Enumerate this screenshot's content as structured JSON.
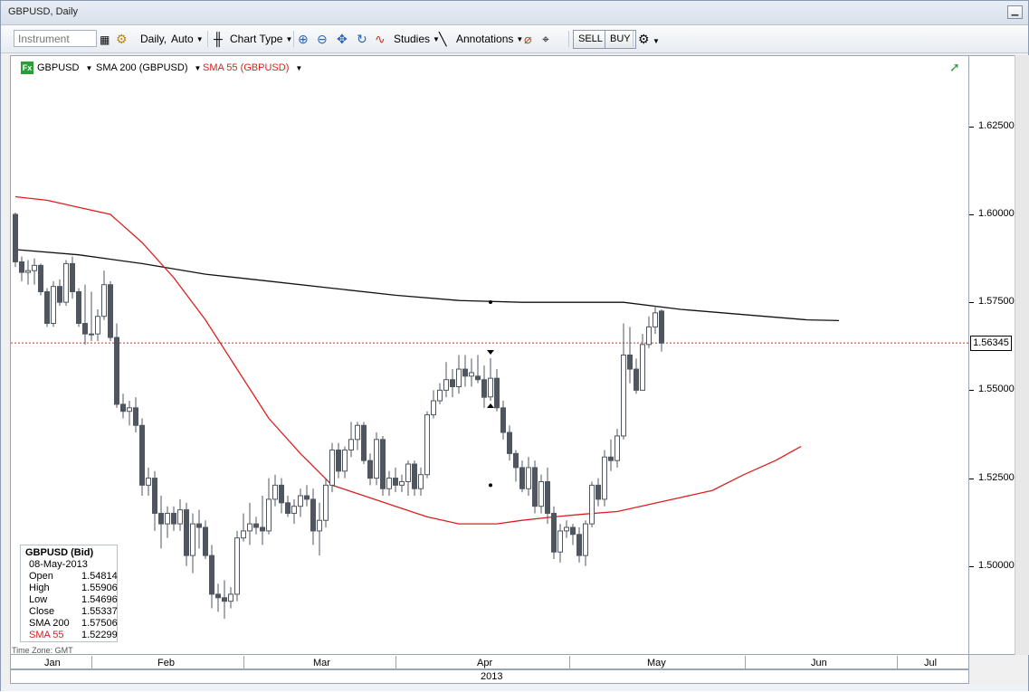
{
  "window": {
    "title": "GBPUSD, Daily"
  },
  "toolbar": {
    "instrument_placeholder": "Instrument",
    "period": "Daily,",
    "scale": "Auto",
    "chart_type": "Chart Type",
    "studies": "Studies",
    "annotations": "Annotations",
    "sell": "SELL",
    "buy": "BUY"
  },
  "legend": {
    "fx": "Fx",
    "instrument": "GBPUSD",
    "sma200": "SMA 200 (GBPUSD)",
    "sma55": "SMA 55 (GBPUSD)"
  },
  "current_price": "1.56345",
  "timezone": "Time Zone: GMT",
  "infobox": {
    "title": "GBPUSD (Bid)",
    "date": "08-May-2013",
    "rows": [
      {
        "label": "Open",
        "value": "1.54814"
      },
      {
        "label": "High",
        "value": "1.55906"
      },
      {
        "label": "Low",
        "value": "1.54696"
      },
      {
        "label": "Close",
        "value": "1.55337"
      },
      {
        "label": "SMA 200",
        "value": "1.57506"
      },
      {
        "label": "SMA 55",
        "value": "1.52299"
      }
    ]
  },
  "colors": {
    "sma200": "#111111",
    "sma55": "#d92020",
    "candle_down": "#4f5660",
    "candle_up": "#ffffff",
    "price_line": "#c0392b"
  },
  "chart_data": {
    "type": "candlestick",
    "y_ticks": [
      "1.62500",
      "1.60000",
      "1.57500",
      "1.55000",
      "1.52500",
      "1.50000"
    ],
    "y_tick_values": [
      1.625,
      1.6,
      1.575,
      1.55,
      1.525,
      1.5
    ],
    "ylim": [
      1.475,
      1.645
    ],
    "x_months": [
      "Jan",
      "Feb",
      "Mar",
      "Apr",
      "May",
      "Jun",
      "Jul"
    ],
    "year": "2013",
    "current_price": 1.56345,
    "candles": [
      [
        1.6,
        1.6005,
        1.585,
        1.5865
      ],
      [
        1.5865,
        1.588,
        1.581,
        1.5835
      ],
      [
        1.5835,
        1.587,
        1.58,
        1.584
      ],
      [
        1.584,
        1.5875,
        1.58,
        1.5855
      ],
      [
        1.5855,
        1.586,
        1.577,
        1.578
      ],
      [
        1.578,
        1.579,
        1.568,
        1.569
      ],
      [
        1.569,
        1.581,
        1.568,
        1.5795
      ],
      [
        1.5795,
        1.5815,
        1.574,
        1.575
      ],
      [
        1.575,
        1.587,
        1.574,
        1.586
      ],
      [
        1.586,
        1.588,
        1.576,
        1.578
      ],
      [
        1.578,
        1.579,
        1.568,
        1.569
      ],
      [
        1.569,
        1.58,
        1.563,
        1.566
      ],
      [
        1.566,
        1.578,
        1.564,
        1.566
      ],
      [
        1.566,
        1.573,
        1.564,
        1.571
      ],
      [
        1.571,
        1.584,
        1.57,
        1.58
      ],
      [
        1.58,
        1.581,
        1.564,
        1.565
      ],
      [
        1.565,
        1.569,
        1.545,
        1.546
      ],
      [
        1.546,
        1.549,
        1.542,
        1.544
      ],
      [
        1.544,
        1.547,
        1.54,
        1.545
      ],
      [
        1.545,
        1.548,
        1.538,
        1.54
      ],
      [
        1.54,
        1.542,
        1.52,
        1.523
      ],
      [
        1.523,
        1.528,
        1.52,
        1.525
      ],
      [
        1.525,
        1.527,
        1.51,
        1.515
      ],
      [
        1.515,
        1.52,
        1.505,
        1.512
      ],
      [
        1.512,
        1.517,
        1.508,
        1.515
      ],
      [
        1.515,
        1.517,
        1.51,
        1.512
      ],
      [
        1.512,
        1.519,
        1.51,
        1.516
      ],
      [
        1.516,
        1.518,
        1.5,
        1.503
      ],
      [
        1.503,
        1.515,
        1.498,
        1.512
      ],
      [
        1.512,
        1.516,
        1.505,
        1.511
      ],
      [
        1.511,
        1.513,
        1.502,
        1.503
      ],
      [
        1.503,
        1.506,
        1.488,
        1.492
      ],
      [
        1.492,
        1.495,
        1.487,
        1.491
      ],
      [
        1.491,
        1.496,
        1.485,
        1.49
      ],
      [
        1.49,
        1.494,
        1.488,
        1.492
      ],
      [
        1.492,
        1.51,
        1.49,
        1.508
      ],
      [
        1.508,
        1.515,
        1.507,
        1.51
      ],
      [
        1.51,
        1.518,
        1.506,
        1.512
      ],
      [
        1.512,
        1.514,
        1.509,
        1.511
      ],
      [
        1.511,
        1.52,
        1.506,
        1.51
      ],
      [
        1.51,
        1.525,
        1.509,
        1.519
      ],
      [
        1.519,
        1.526,
        1.517,
        1.523
      ],
      [
        1.523,
        1.525,
        1.515,
        1.518
      ],
      [
        1.518,
        1.52,
        1.514,
        1.515
      ],
      [
        1.515,
        1.519,
        1.512,
        1.517
      ],
      [
        1.517,
        1.522,
        1.514,
        1.52
      ],
      [
        1.52,
        1.523,
        1.517,
        1.519
      ],
      [
        1.519,
        1.522,
        1.506,
        1.51
      ],
      [
        1.51,
        1.518,
        1.503,
        1.513
      ],
      [
        1.513,
        1.525,
        1.511,
        1.523
      ],
      [
        1.523,
        1.535,
        1.521,
        1.533
      ],
      [
        1.533,
        1.535,
        1.525,
        1.527
      ],
      [
        1.527,
        1.534,
        1.525,
        1.533
      ],
      [
        1.533,
        1.541,
        1.531,
        1.536
      ],
      [
        1.536,
        1.541,
        1.533,
        1.54
      ],
      [
        1.54,
        1.541,
        1.529,
        1.53
      ],
      [
        1.53,
        1.532,
        1.523,
        1.525
      ],
      [
        1.525,
        1.538,
        1.523,
        1.536
      ],
      [
        1.536,
        1.537,
        1.52,
        1.522
      ],
      [
        1.522,
        1.527,
        1.52,
        1.525
      ],
      [
        1.525,
        1.528,
        1.521,
        1.523
      ],
      [
        1.523,
        1.526,
        1.521,
        1.524
      ],
      [
        1.524,
        1.53,
        1.52,
        1.529
      ],
      [
        1.529,
        1.53,
        1.52,
        1.522
      ],
      [
        1.522,
        1.528,
        1.52,
        1.526
      ],
      [
        1.526,
        1.544,
        1.525,
        1.543
      ],
      [
        1.543,
        1.55,
        1.542,
        1.547
      ],
      [
        1.547,
        1.552,
        1.546,
        1.55
      ],
      [
        1.55,
        1.558,
        1.548,
        1.553
      ],
      [
        1.553,
        1.556,
        1.548,
        1.551
      ],
      [
        1.551,
        1.56,
        1.549,
        1.556
      ],
      [
        1.556,
        1.56,
        1.551,
        1.554
      ],
      [
        1.554,
        1.559,
        1.551,
        1.555
      ],
      [
        1.554,
        1.56,
        1.552,
        1.553
      ],
      [
        1.553,
        1.557,
        1.545,
        1.548
      ],
      [
        1.5481,
        1.5591,
        1.547,
        1.5534
      ],
      [
        1.5534,
        1.556,
        1.544,
        1.545
      ],
      [
        1.545,
        1.547,
        1.536,
        1.538
      ],
      [
        1.538,
        1.54,
        1.53,
        1.532
      ],
      [
        1.532,
        1.533,
        1.524,
        1.528
      ],
      [
        1.528,
        1.53,
        1.521,
        1.522
      ],
      [
        1.522,
        1.531,
        1.52,
        1.528
      ],
      [
        1.528,
        1.53,
        1.515,
        1.517
      ],
      [
        1.517,
        1.526,
        1.515,
        1.524
      ],
      [
        1.524,
        1.528,
        1.512,
        1.515
      ],
      [
        1.515,
        1.517,
        1.502,
        1.504
      ],
      [
        1.504,
        1.512,
        1.501,
        1.51
      ],
      [
        1.51,
        1.513,
        1.508,
        1.511
      ],
      [
        1.511,
        1.512,
        1.506,
        1.509
      ],
      [
        1.509,
        1.511,
        1.501,
        1.503
      ],
      [
        1.503,
        1.513,
        1.5,
        1.512
      ],
      [
        1.512,
        1.524,
        1.511,
        1.523
      ],
      [
        1.523,
        1.525,
        1.517,
        1.519
      ],
      [
        1.519,
        1.533,
        1.517,
        1.531
      ],
      [
        1.531,
        1.536,
        1.527,
        1.53
      ],
      [
        1.53,
        1.539,
        1.528,
        1.537
      ],
      [
        1.537,
        1.569,
        1.536,
        1.56
      ],
      [
        1.56,
        1.568,
        1.552,
        1.556
      ],
      [
        1.556,
        1.559,
        1.549,
        1.55
      ],
      [
        1.55,
        1.566,
        1.55,
        1.563
      ],
      [
        1.563,
        1.571,
        1.562,
        1.568
      ],
      [
        1.568,
        1.574,
        1.566,
        1.572
      ],
      [
        1.5725,
        1.573,
        1.561,
        1.5634
      ]
    ],
    "sma200": [
      [
        0,
        1.59
      ],
      [
        10,
        1.5885
      ],
      [
        20,
        1.586
      ],
      [
        30,
        1.583
      ],
      [
        40,
        1.581
      ],
      [
        50,
        1.579
      ],
      [
        60,
        1.577
      ],
      [
        70,
        1.5755
      ],
      [
        80,
        1.575
      ],
      [
        90,
        1.575
      ],
      [
        96,
        1.575
      ],
      [
        105,
        1.573
      ],
      [
        115,
        1.5715
      ],
      [
        125,
        1.57
      ],
      [
        130,
        1.5698
      ]
    ],
    "sma55": [
      [
        0,
        1.605
      ],
      [
        5,
        1.604
      ],
      [
        10,
        1.602
      ],
      [
        15,
        1.6
      ],
      [
        20,
        1.592
      ],
      [
        25,
        1.582
      ],
      [
        30,
        1.57
      ],
      [
        35,
        1.556
      ],
      [
        40,
        1.542
      ],
      [
        45,
        1.532
      ],
      [
        50,
        1.523
      ],
      [
        55,
        1.52
      ],
      [
        60,
        1.517
      ],
      [
        65,
        1.514
      ],
      [
        70,
        1.512
      ],
      [
        76,
        1.512
      ],
      [
        80,
        1.513
      ],
      [
        85,
        1.514
      ],
      [
        90,
        1.5148
      ],
      [
        95,
        1.5155
      ],
      [
        100,
        1.5175
      ],
      [
        105,
        1.5195
      ],
      [
        110,
        1.5215
      ],
      [
        115,
        1.526
      ],
      [
        120,
        1.53
      ],
      [
        124,
        1.534
      ]
    ]
  }
}
